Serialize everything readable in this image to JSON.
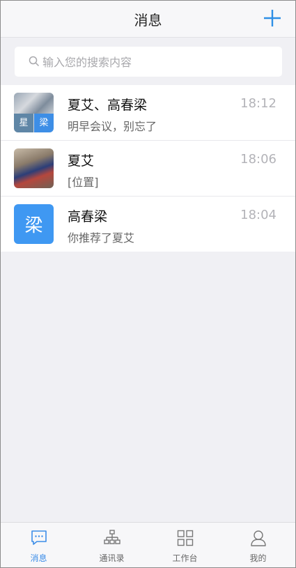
{
  "header": {
    "title": "消息"
  },
  "search": {
    "placeholder": "输入您的搜索内容"
  },
  "conversations": [
    {
      "name": "夏艾、高春梁",
      "time": "18:12",
      "preview": "明早会议，别忘了",
      "avatar_cells": [
        "星",
        "梁"
      ]
    },
    {
      "name": "夏艾",
      "time": "18:06",
      "preview": "[位置]"
    },
    {
      "name": "高春梁",
      "time": "18:04",
      "preview": "你推荐了夏艾",
      "avatar_letter": "梁"
    }
  ],
  "tabs": [
    {
      "label": "消息",
      "icon": "chat-icon",
      "active": true
    },
    {
      "label": "通讯录",
      "icon": "org-chart-icon",
      "active": false
    },
    {
      "label": "工作台",
      "icon": "grid-icon",
      "active": false
    },
    {
      "label": "我的",
      "icon": "person-icon",
      "active": false
    }
  ],
  "colors": {
    "accent": "#3c8de8",
    "avatar_blue": "#3f98f2"
  }
}
